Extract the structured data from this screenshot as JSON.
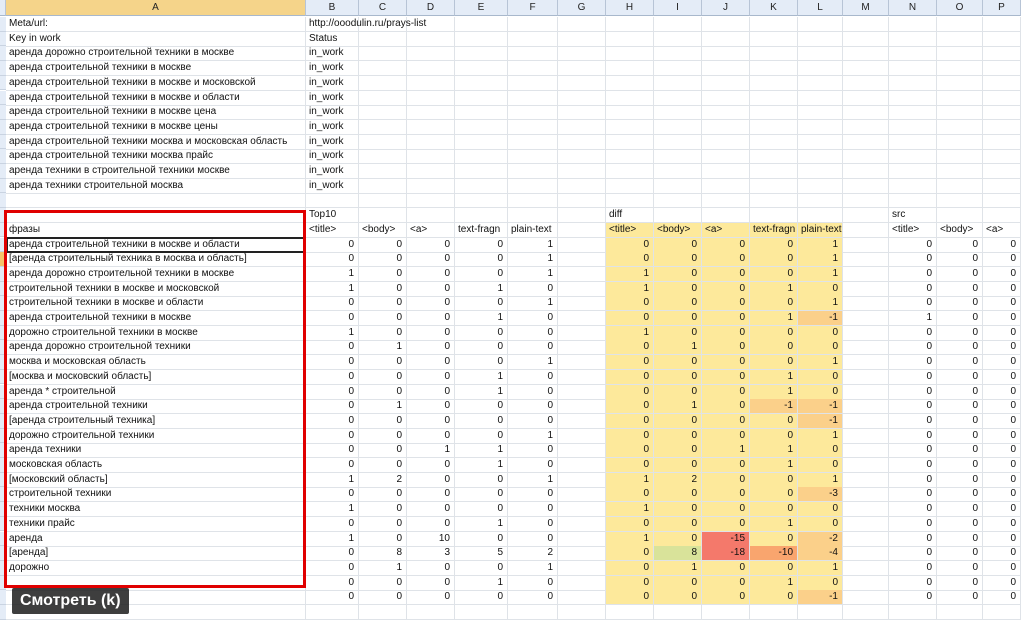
{
  "columns": [
    "A",
    "B",
    "C",
    "D",
    "E",
    "F",
    "G",
    "H",
    "I",
    "J",
    "K",
    "L",
    "M",
    "N",
    "O",
    "P"
  ],
  "selected_column": "A",
  "meta": {
    "url_label": "Meta/url:",
    "url_value": "http://ooodulin.ru/prays-list",
    "key_label": "Key in work",
    "status_label": "Status",
    "keys": [
      {
        "key": "аренда дорожно строительной техники в москве",
        "status": "in_work"
      },
      {
        "key": "аренда строительной техники в москве",
        "status": "in_work"
      },
      {
        "key": "аренда строительной техники в москве и московской",
        "status": "in_work"
      },
      {
        "key": "аренда строительной техники в москве и области",
        "status": "in_work"
      },
      {
        "key": "аренда строительной техники в москве цена",
        "status": "in_work"
      },
      {
        "key": "аренда строительной техники в москве цены",
        "status": "in_work"
      },
      {
        "key": "аренда строительной техники москва и московская область",
        "status": "in_work"
      },
      {
        "key": "аренда строительной техники москва прайс",
        "status": "in_work"
      },
      {
        "key": "аренда техники в строительной техники москве",
        "status": "in_work"
      },
      {
        "key": "аренда техники строительной москва",
        "status": "in_work"
      }
    ]
  },
  "groups": {
    "top10": "Top10",
    "diff": "diff",
    "src": "src"
  },
  "phrase_header": "фразы",
  "metric_headers": [
    "<title>",
    "<body>",
    "<a>",
    "text-fragn",
    "plain-text"
  ],
  "src_headers": [
    "<title>",
    "<body>",
    "<a>"
  ],
  "phrases": [
    {
      "text": "аренда строительной техники в москве и области",
      "top": [
        "0",
        "0",
        "0",
        "0",
        "1"
      ],
      "diff": [
        "0",
        "0",
        "0",
        "0",
        "1"
      ],
      "src": [
        "0",
        "0",
        "0"
      ]
    },
    {
      "text": "[аренда строительный техника в москва и область]",
      "top": [
        "0",
        "0",
        "0",
        "0",
        "1"
      ],
      "diff": [
        "0",
        "0",
        "0",
        "0",
        "1"
      ],
      "src": [
        "0",
        "0",
        "0"
      ]
    },
    {
      "text": "аренда дорожно строительной техники в москве",
      "top": [
        "1",
        "0",
        "0",
        "0",
        "1"
      ],
      "diff": [
        "1",
        "0",
        "0",
        "0",
        "1"
      ],
      "src": [
        "0",
        "0",
        "0"
      ]
    },
    {
      "text": "строительной техники в москве и московской",
      "top": [
        "1",
        "0",
        "0",
        "1",
        "0"
      ],
      "diff": [
        "1",
        "0",
        "0",
        "1",
        "0"
      ],
      "src": [
        "0",
        "0",
        "0"
      ]
    },
    {
      "text": "строительной техники в москве и области",
      "top": [
        "0",
        "0",
        "0",
        "0",
        "1"
      ],
      "diff": [
        "0",
        "0",
        "0",
        "0",
        "1"
      ],
      "src": [
        "0",
        "0",
        "0"
      ]
    },
    {
      "text": "аренда строительной техники в москве",
      "top": [
        "0",
        "0",
        "0",
        "1",
        "0"
      ],
      "diff": [
        "0",
        "0",
        "0",
        "1",
        "-1"
      ],
      "src": [
        "1",
        "0",
        "0"
      ]
    },
    {
      "text": "дорожно строительной техники в москве",
      "top": [
        "1",
        "0",
        "0",
        "0",
        "0"
      ],
      "diff": [
        "1",
        "0",
        "0",
        "0",
        "0"
      ],
      "src": [
        "0",
        "0",
        "0"
      ]
    },
    {
      "text": "аренда дорожно строительной техники",
      "top": [
        "0",
        "1",
        "0",
        "0",
        "0"
      ],
      "diff": [
        "0",
        "1",
        "0",
        "0",
        "0"
      ],
      "src": [
        "0",
        "0",
        "0"
      ]
    },
    {
      "text": "москва и московская область",
      "top": [
        "0",
        "0",
        "0",
        "0",
        "1"
      ],
      "diff": [
        "0",
        "0",
        "0",
        "0",
        "1"
      ],
      "src": [
        "0",
        "0",
        "0"
      ]
    },
    {
      "text": "[москва и московский область]",
      "top": [
        "0",
        "0",
        "0",
        "1",
        "0"
      ],
      "diff": [
        "0",
        "0",
        "0",
        "1",
        "0"
      ],
      "src": [
        "0",
        "0",
        "0"
      ]
    },
    {
      "text": "аренда * строительной",
      "top": [
        "0",
        "0",
        "0",
        "1",
        "0"
      ],
      "diff": [
        "0",
        "0",
        "0",
        "1",
        "0"
      ],
      "src": [
        "0",
        "0",
        "0"
      ]
    },
    {
      "text": "аренда строительной техники",
      "top": [
        "0",
        "1",
        "0",
        "0",
        "0"
      ],
      "diff": [
        "0",
        "1",
        "0",
        "-1",
        "-1"
      ],
      "src": [
        "0",
        "0",
        "0"
      ]
    },
    {
      "text": "[аренда строительный техника]",
      "top": [
        "0",
        "0",
        "0",
        "0",
        "0"
      ],
      "diff": [
        "0",
        "0",
        "0",
        "0",
        "-1"
      ],
      "src": [
        "0",
        "0",
        "0"
      ]
    },
    {
      "text": "дорожно строительной техники",
      "top": [
        "0",
        "0",
        "0",
        "0",
        "1"
      ],
      "diff": [
        "0",
        "0",
        "0",
        "0",
        "1"
      ],
      "src": [
        "0",
        "0",
        "0"
      ]
    },
    {
      "text": "аренда техники",
      "top": [
        "0",
        "0",
        "1",
        "1",
        "0"
      ],
      "diff": [
        "0",
        "0",
        "1",
        "1",
        "0"
      ],
      "src": [
        "0",
        "0",
        "0"
      ]
    },
    {
      "text": "московская область",
      "top": [
        "0",
        "0",
        "0",
        "1",
        "0"
      ],
      "diff": [
        "0",
        "0",
        "0",
        "1",
        "0"
      ],
      "src": [
        "0",
        "0",
        "0"
      ]
    },
    {
      "text": "[московский область]",
      "top": [
        "1",
        "2",
        "0",
        "0",
        "1"
      ],
      "diff": [
        "1",
        "2",
        "0",
        "0",
        "1"
      ],
      "src": [
        "0",
        "0",
        "0"
      ]
    },
    {
      "text": "строительной техники",
      "top": [
        "0",
        "0",
        "0",
        "0",
        "0"
      ],
      "diff": [
        "0",
        "0",
        "0",
        "0",
        "-3"
      ],
      "src": [
        "0",
        "0",
        "0"
      ]
    },
    {
      "text": "техники москва",
      "top": [
        "1",
        "0",
        "0",
        "0",
        "0"
      ],
      "diff": [
        "1",
        "0",
        "0",
        "0",
        "0"
      ],
      "src": [
        "0",
        "0",
        "0"
      ]
    },
    {
      "text": "техники прайс",
      "top": [
        "0",
        "0",
        "0",
        "1",
        "0"
      ],
      "diff": [
        "0",
        "0",
        "0",
        "1",
        "0"
      ],
      "src": [
        "0",
        "0",
        "0"
      ]
    },
    {
      "text": "аренда",
      "top": [
        "1",
        "0",
        "10",
        "0",
        "0"
      ],
      "diff": [
        "1",
        "0",
        "-15",
        "0",
        "-2"
      ],
      "src": [
        "0",
        "0",
        "0"
      ]
    },
    {
      "text": "[аренда]",
      "top": [
        "0",
        "8",
        "3",
        "5",
        "2"
      ],
      "diff": [
        "0",
        "8",
        "-18",
        "-10",
        "-4"
      ],
      "src": [
        "0",
        "0",
        "0"
      ]
    },
    {
      "text": "дорожно",
      "top": [
        "0",
        "1",
        "0",
        "0",
        "1"
      ],
      "diff": [
        "0",
        "1",
        "0",
        "0",
        "1"
      ],
      "src": [
        "0",
        "0",
        "0"
      ]
    },
    {
      "text": "",
      "top": [
        "0",
        "0",
        "0",
        "1",
        "0"
      ],
      "diff": [
        "0",
        "0",
        "0",
        "1",
        "0"
      ],
      "src": [
        "0",
        "0",
        "0"
      ]
    },
    {
      "text": "",
      "top": [
        "0",
        "0",
        "0",
        "0",
        "0"
      ],
      "diff": [
        "0",
        "0",
        "0",
        "0",
        "-1"
      ],
      "src": [
        "0",
        "0",
        "0"
      ]
    }
  ],
  "colors": {
    "diff_base": "#fde99b",
    "diff_neg_small": "#fbd08a",
    "diff_neg_mid": "#f9a56e",
    "diff_neg_strong": "#f4796b",
    "diff_pos_high": "#d9e39a",
    "highlight_border": "#e00000"
  },
  "overlay": {
    "watch_label": "Смотреть (k)"
  }
}
